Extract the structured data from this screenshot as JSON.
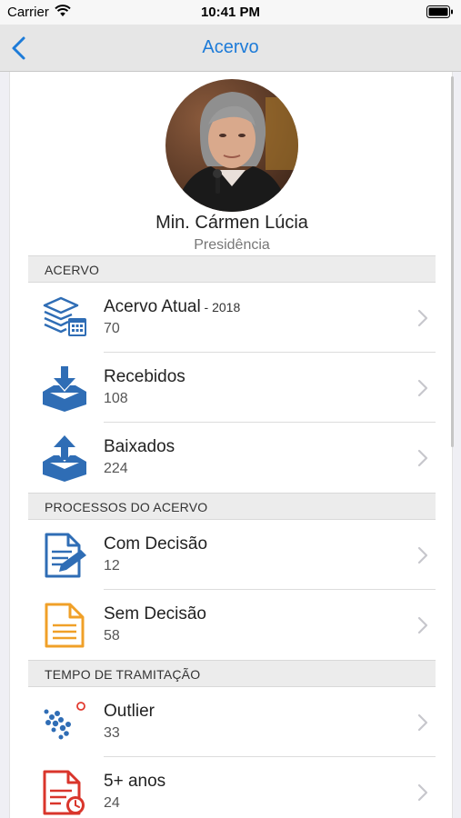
{
  "status_bar": {
    "carrier": "Carrier",
    "time": "10:41 PM"
  },
  "nav": {
    "title": "Acervo",
    "back_icon": "chevron-left-icon"
  },
  "profile": {
    "name": "Min. Cármen Lúcia",
    "role": "Presidência"
  },
  "sections": [
    {
      "title": "ACERVO",
      "items": [
        {
          "label": "Acervo Atual",
          "sublabel": " - 2018",
          "count": "70",
          "icon": "stacked-calendar-icon"
        },
        {
          "label": "Recebidos",
          "sublabel": "",
          "count": "108",
          "icon": "inbox-download-icon"
        },
        {
          "label": "Baixados",
          "sublabel": "",
          "count": "224",
          "icon": "inbox-upload-icon"
        }
      ]
    },
    {
      "title": "PROCESSOS DO ACERVO",
      "items": [
        {
          "label": "Com Decisão",
          "sublabel": "",
          "count": "12",
          "icon": "document-edit-icon"
        },
        {
          "label": "Sem Decisão",
          "sublabel": "",
          "count": "58",
          "icon": "document-lines-icon"
        }
      ]
    },
    {
      "title": "TEMPO DE TRAMITAÇÃO",
      "items": [
        {
          "label": "Outlier",
          "sublabel": "",
          "count": "33",
          "icon": "scatter-outlier-icon"
        },
        {
          "label": "5+ anos",
          "sublabel": "",
          "count": "24",
          "icon": "document-clock-icon"
        }
      ]
    }
  ],
  "colors": {
    "accent": "#1d7bd8",
    "icon_blue": "#2f6db5",
    "icon_orange": "#f0a028",
    "icon_red": "#d9352b"
  }
}
